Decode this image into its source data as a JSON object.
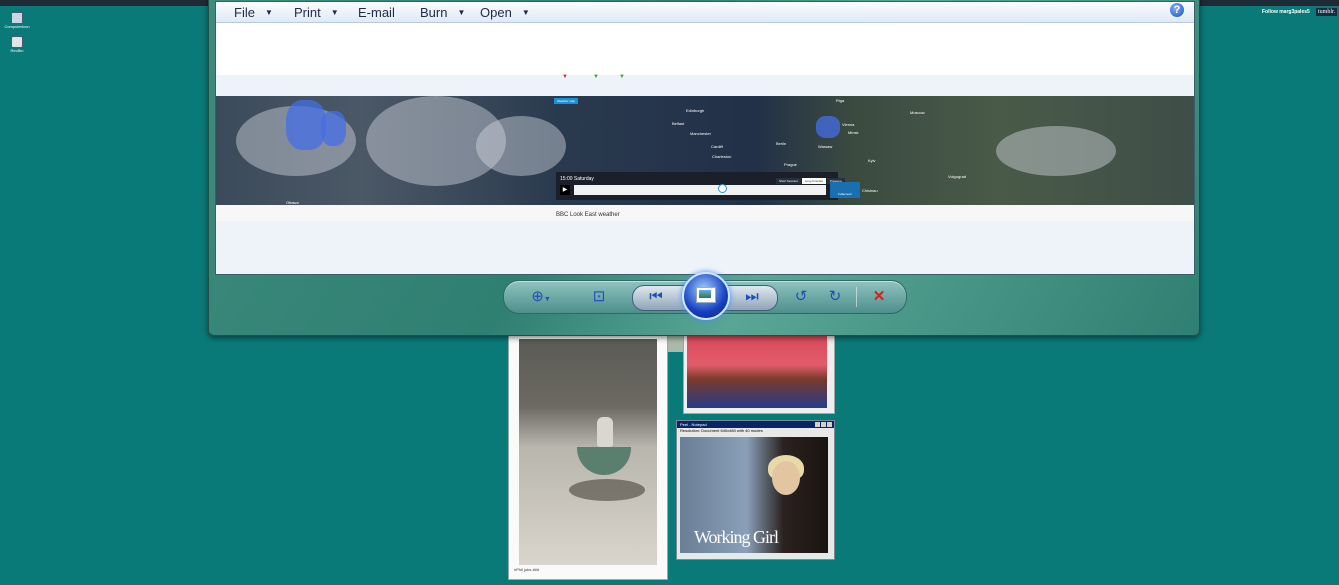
{
  "desktop": {
    "icons": [
      {
        "label": "ComputerIcon",
        "name": "computer-icon"
      },
      {
        "label": "RecBin",
        "name": "recycle-bin-icon"
      }
    ],
    "tumblr_follow": "Follow marg3pales5",
    "tumblr_logo": "tumblr."
  },
  "viewer": {
    "menu": {
      "file": "File",
      "print": "Print",
      "email": "E-mail",
      "burn": "Burn",
      "open": "Open",
      "help": "?"
    },
    "image": {
      "map_tag": "Weather map",
      "time_label": "15:00 Saturday",
      "cities": [
        "Edinburgh",
        "Belfast",
        "Manchester",
        "Cardiff",
        "Paris",
        "Berlin",
        "Prague",
        "Warsaw",
        "Vienna",
        "Riga",
        "Minsk",
        "Kyiv",
        "Moscow",
        "Volgograd",
        "Chisinau",
        "Ottawa",
        "Charleston"
      ],
      "buttons": {
        "short": "Short forecast",
        "long": "Long forecast",
        "pressure": "Pressure",
        "fullscreen": "Fullscreen"
      },
      "caption": "BBC Look East weather"
    },
    "controls": {
      "zoom": "zoom-icon",
      "fit": "fit-window-icon",
      "previous": "previous-icon",
      "slideshow": "slideshow-icon",
      "next": "next-icon",
      "rotate_ccw": "rotate-ccw-icon",
      "rotate_cw": "rotate-cw-icon",
      "delete": "delete-icon"
    }
  },
  "background_windows": {
    "cat_caption": "nPhil jobs ###",
    "notepad_title": "Peel - Notepad",
    "notepad_menu": "Resolution: Document 640x480 with 40 modes",
    "movie_title": "Working Girl"
  }
}
